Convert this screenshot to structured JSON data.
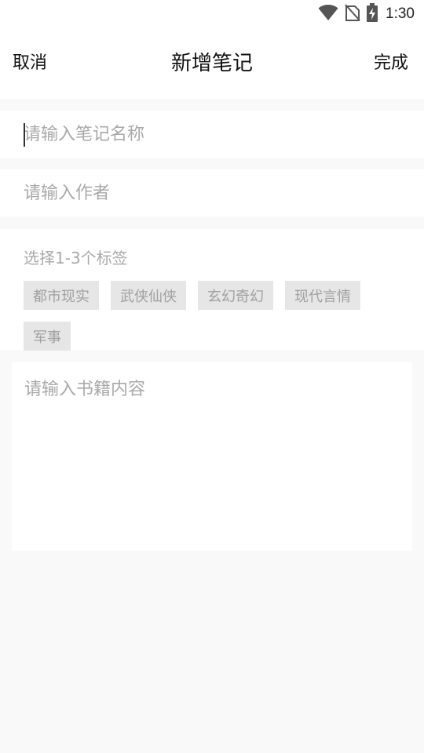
{
  "status_bar": {
    "time": "1:30",
    "icons": [
      "wifi-icon",
      "no-sim-icon",
      "battery-charging-icon"
    ]
  },
  "header": {
    "cancel_label": "取消",
    "title": "新增笔记",
    "done_label": "完成"
  },
  "form": {
    "note_name": {
      "value": "",
      "placeholder": "请输入笔记名称"
    },
    "author": {
      "value": "",
      "placeholder": "请输入作者"
    },
    "tags": {
      "label": "选择1-3个标签",
      "options": [
        "都市现实",
        "武侠仙侠",
        "玄幻奇幻",
        "现代言情",
        "军事"
      ]
    },
    "content": {
      "value": "",
      "placeholder": "请输入书籍内容"
    }
  },
  "colors": {
    "background": "#f9f9f9",
    "surface": "#ffffff",
    "placeholder": "#a9a9a9",
    "tag_bg": "#e6e6e6",
    "text": "#111111"
  }
}
